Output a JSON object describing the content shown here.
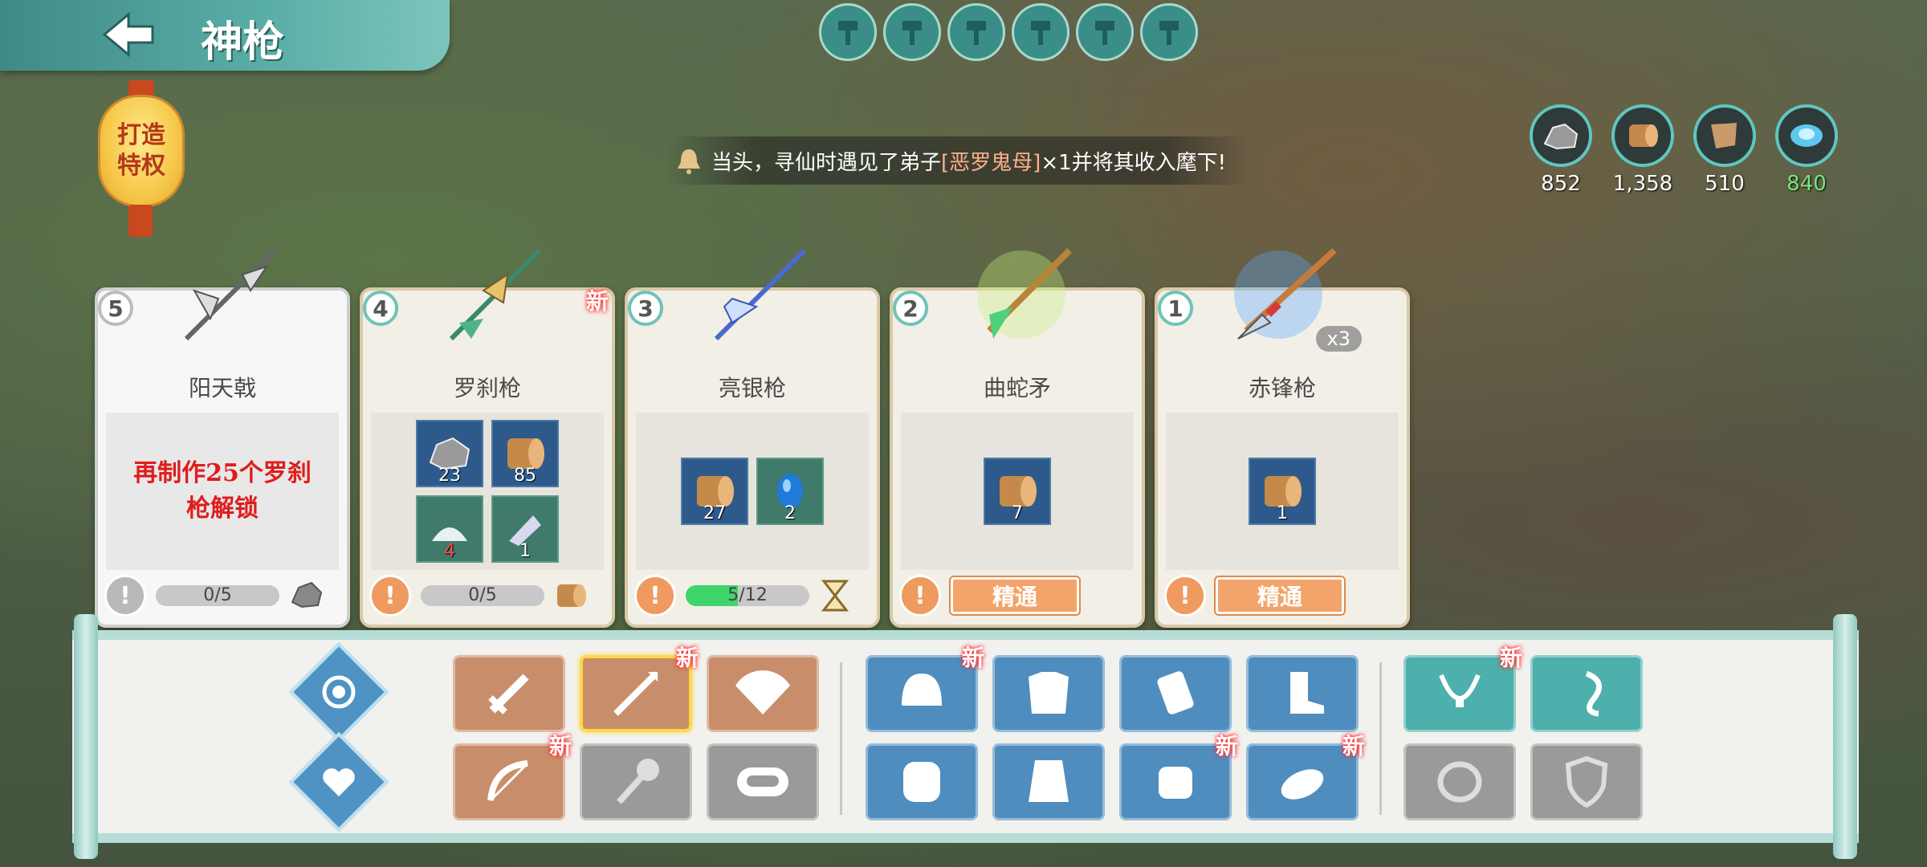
{
  "header": {
    "title": "神枪",
    "back_label": ""
  },
  "lantern": {
    "line1": "打造",
    "line2": "特权"
  },
  "top_slots": [
    "hammer-slot-1",
    "hammer-slot-2",
    "hammer-slot-3",
    "hammer-slot-4",
    "hammer-slot-5",
    "hammer-slot-6"
  ],
  "notice": {
    "prefix": "当头，寻仙时遇见了弟子",
    "highlight": "[恶罗鬼母]",
    "suffix": "×1并将其收入麾下!"
  },
  "resources": [
    {
      "icon": "ore-icon",
      "value": "852",
      "color": "#ffffff"
    },
    {
      "icon": "wood-icon",
      "value": "1,358",
      "color": "#ffffff"
    },
    {
      "icon": "leather-icon",
      "value": "510",
      "color": "#ffffff"
    },
    {
      "icon": "crystal-icon",
      "value": "840",
      "color": "#7be37b"
    }
  ],
  "cards": [
    {
      "num": "5",
      "name": "阳天戟",
      "locked": true,
      "unlock_text": "再制作25个罗刹枪解锁",
      "progress": "0/5"
    },
    {
      "num": "4",
      "name": "罗刹枪",
      "new": "新",
      "progress": "0/5",
      "mats": [
        {
          "icon": "ore-icon",
          "count": "23"
        },
        {
          "icon": "wood-icon",
          "count": "85"
        },
        {
          "icon": "silk-icon",
          "count": "4"
        },
        {
          "icon": "feather-icon",
          "count": "1"
        }
      ]
    },
    {
      "num": "3",
      "name": "亮银枪",
      "progress": "5/12",
      "progress_fraction": 0.42,
      "mats": [
        {
          "icon": "wood-icon",
          "count": "27"
        },
        {
          "icon": "gem-icon",
          "count": "2"
        }
      ]
    },
    {
      "num": "2",
      "name": "曲蛇矛",
      "button": "精通",
      "mats": [
        {
          "icon": "wood-icon",
          "count": "7"
        }
      ]
    },
    {
      "num": "1",
      "name": "赤锋枪",
      "button": "精通",
      "multiplier": "x3",
      "mats": [
        {
          "icon": "wood-icon",
          "count": "1"
        }
      ]
    }
  ],
  "categories": {
    "new_tag": "新",
    "colors": {
      "brown": "#c88d6a",
      "blue": "#4f8dbf",
      "teal": "#4db0ac",
      "gray": "#9a9a9a",
      "selected": "#ffd84a"
    }
  }
}
